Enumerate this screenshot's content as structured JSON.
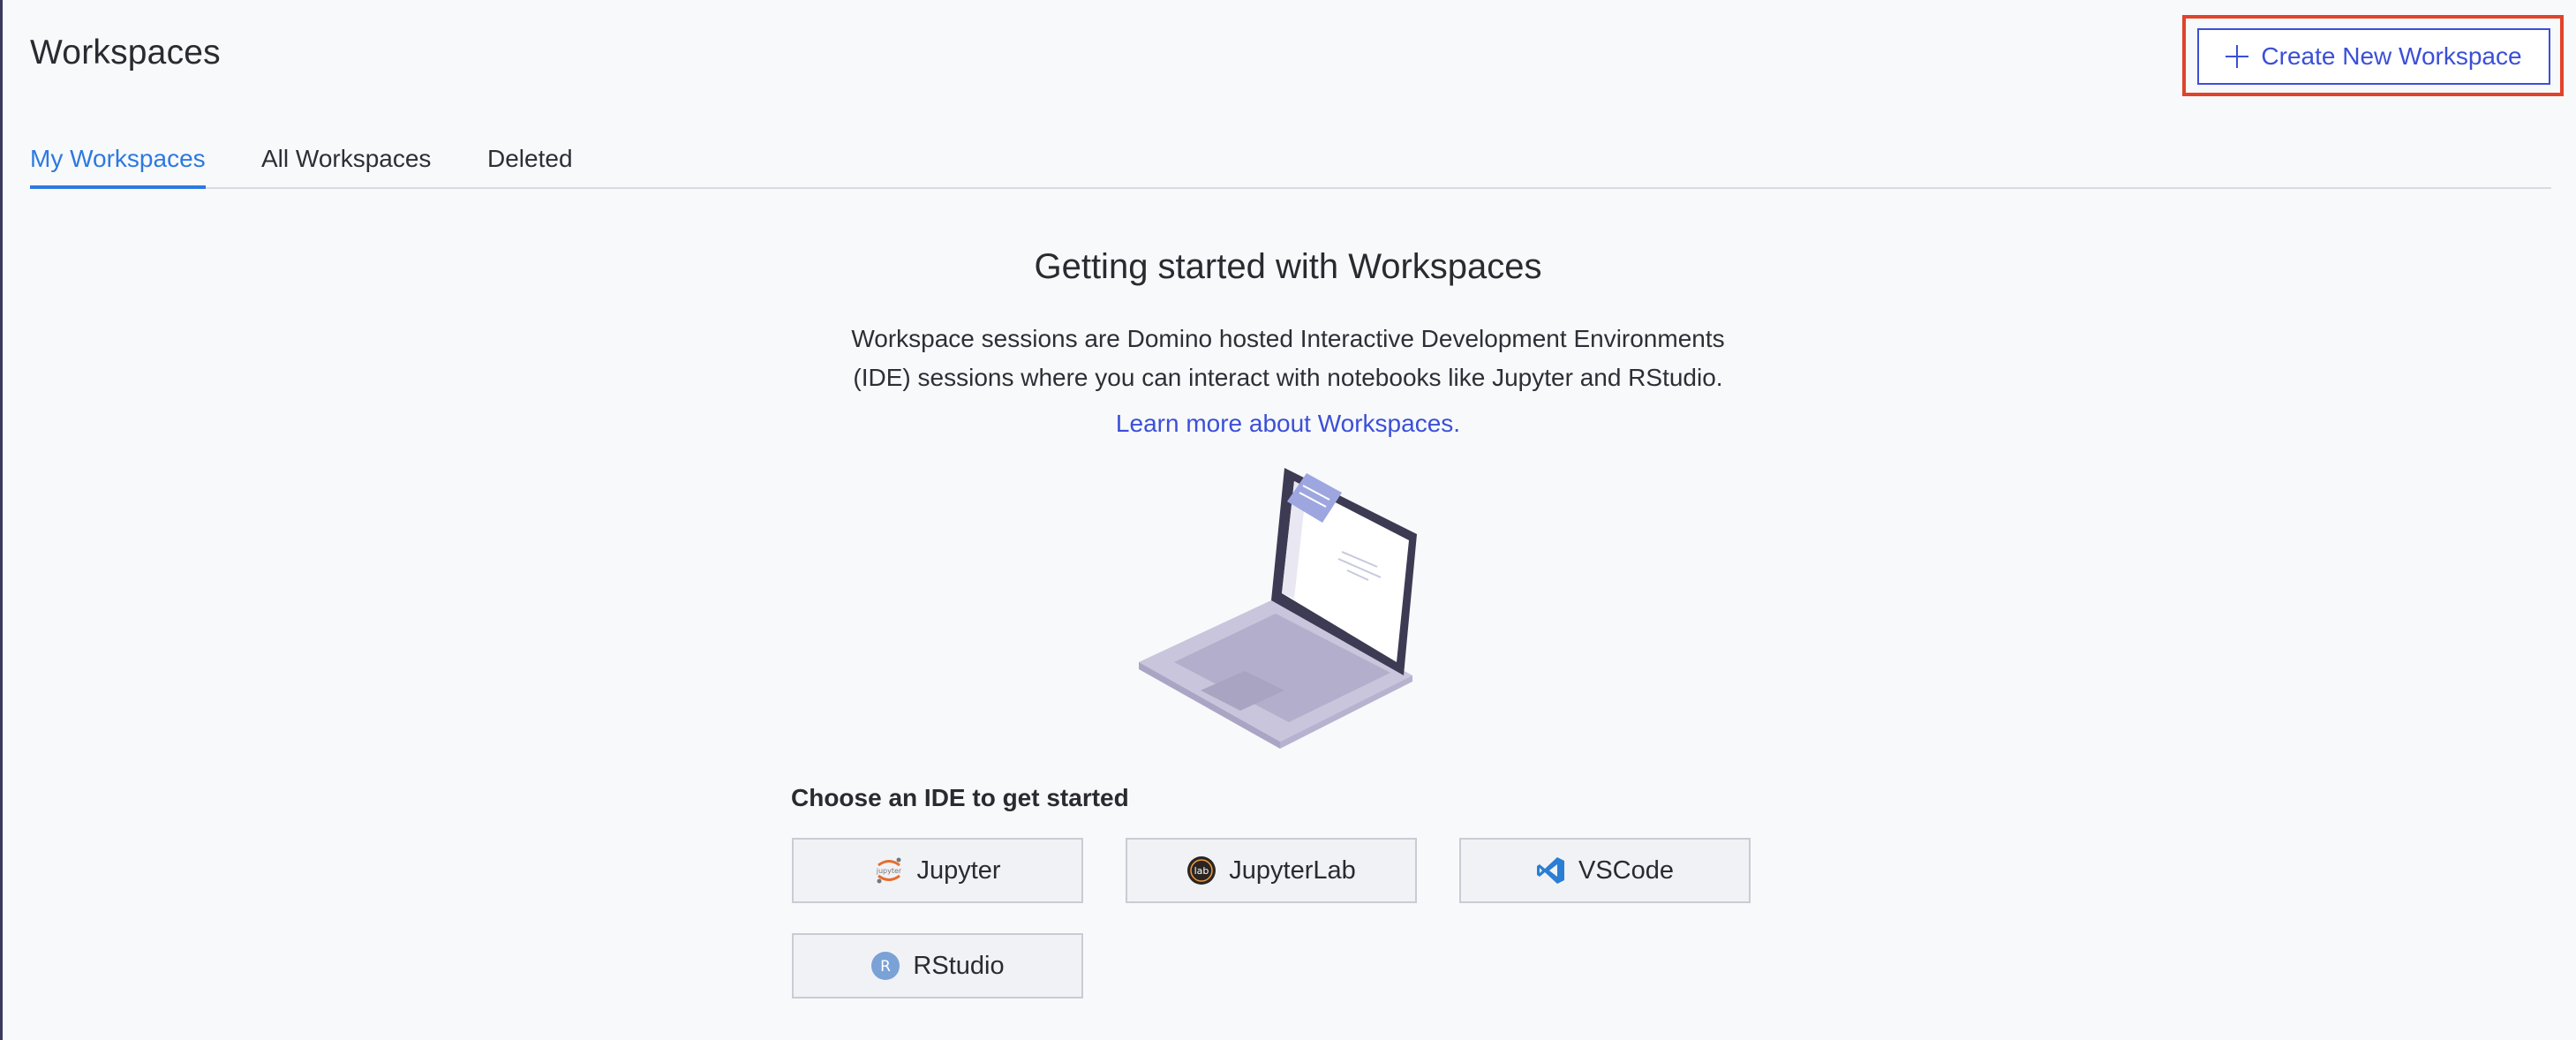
{
  "header": {
    "title": "Workspaces",
    "create_button_label": "Create New Workspace"
  },
  "tabs": [
    {
      "label": "My Workspaces",
      "active": true
    },
    {
      "label": "All Workspaces",
      "active": false
    },
    {
      "label": "Deleted",
      "active": false
    }
  ],
  "empty_state": {
    "title": "Getting started with Workspaces",
    "description_line1": "Workspace sessions are Domino hosted Interactive Development Environments",
    "description_line2": "(IDE) sessions where you can interact with notebooks like Jupyter and RStudio.",
    "learn_more_link": "Learn more about Workspaces.",
    "illustration": "laptop-illustration"
  },
  "ide_section": {
    "heading": "Choose an IDE to get started",
    "ides": [
      {
        "label": "Jupyter",
        "icon": "jupyter-icon"
      },
      {
        "label": "JupyterLab",
        "icon": "jupyterlab-icon",
        "icon_text": "lab"
      },
      {
        "label": "VSCode",
        "icon": "vscode-icon"
      },
      {
        "label": "RStudio",
        "icon": "rstudio-icon",
        "icon_text": "R"
      }
    ]
  },
  "colors": {
    "accent": "#3b4fd8",
    "active_tab": "#2d79e0",
    "highlight": "#e0432a",
    "background": "#f8f9fb"
  }
}
